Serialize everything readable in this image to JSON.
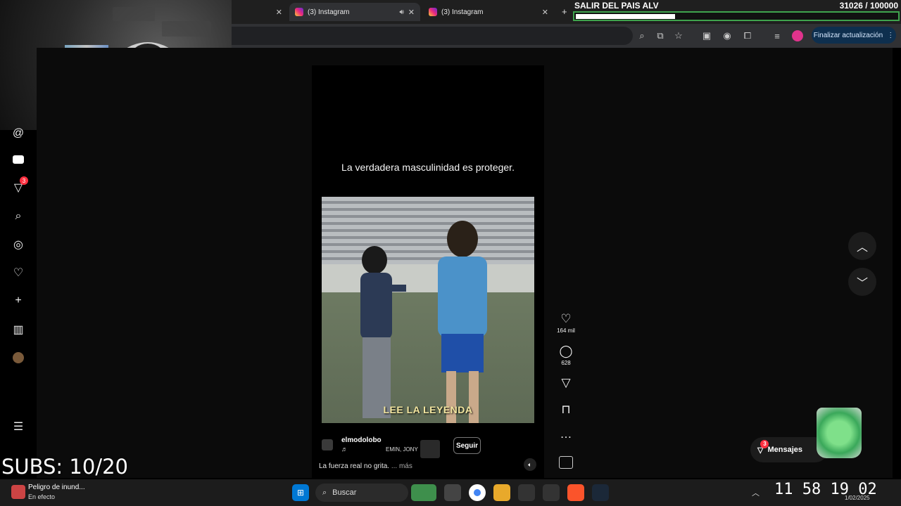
{
  "tabs": [
    {
      "label": "(3) Instagram",
      "close": "✕"
    },
    {
      "label": "(3) Instagram",
      "close": "✕"
    }
  ],
  "browser": {
    "update_label": "Finalizar actualización",
    "new_tab": "+"
  },
  "goal": {
    "title": "SALIR DEL PAIS ALV",
    "count": "31026 / 100000",
    "progress": 0.31026,
    "bar_color": "#3fa34d"
  },
  "sidebar": {
    "messages_badge": "3"
  },
  "reel": {
    "caption": "La verdadera masculinidad es proteger.",
    "video_overlay": "LEE LA LEYENDA",
    "author": "elmodolobo",
    "music_icon": "♬",
    "collab": "EMIN, JONY",
    "follow": "Seguir",
    "description": "La fuerza real no grita.",
    "more": "... más",
    "likes": "164 mil",
    "comments": "628"
  },
  "messages": {
    "label": "Mensajes",
    "badge": "3"
  },
  "overlay": {
    "subs": "SUBS: 10/20"
  },
  "taskbar": {
    "weather_title": "Peligro de inund...",
    "weather_sub": "En efecto",
    "search": "Buscar",
    "timer": "11 58 19 02",
    "date": "1/02/2025"
  }
}
